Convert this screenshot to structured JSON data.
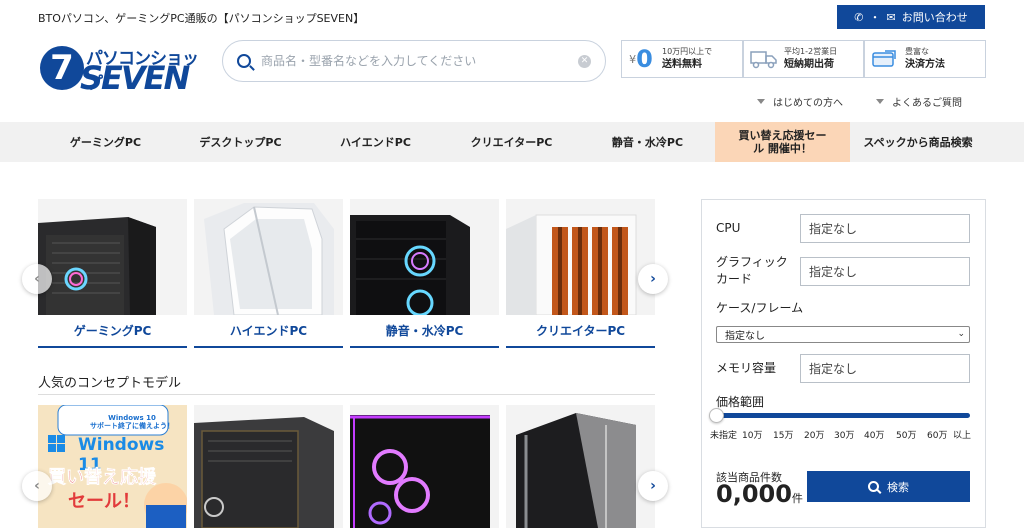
{
  "header": {
    "tagline": "BTOパソコン、ゲーミングPC通販の【パソコンショップSEVEN】",
    "contact_label": "お問い合わせ",
    "logo_small": "パソコンショップ",
    "logo_big": "SEVEN",
    "logo_digit": "7"
  },
  "search": {
    "placeholder": "商品名・型番名などを入力してください"
  },
  "info": [
    {
      "small": "10万円以上で",
      "bold": "送料無料",
      "icon": "free-shipping-icon",
      "zero": "0",
      "yen": "¥"
    },
    {
      "small": "平均1-2営業日",
      "bold": "短納期出荷",
      "icon": "truck-icon"
    },
    {
      "small": "豊富な",
      "bold": "決済方法",
      "icon": "payment-icon"
    }
  ],
  "help_links": [
    {
      "label": "はじめての方へ"
    },
    {
      "label": "よくあるご質問"
    }
  ],
  "nav": [
    {
      "label": "ゲーミングPC"
    },
    {
      "label": "デスクトップPC"
    },
    {
      "label": "ハイエンドPC"
    },
    {
      "label": "クリエイターPC"
    },
    {
      "label": "静音・水冷PC"
    },
    {
      "label": "買い替え応援セール 開催中！"
    },
    {
      "label": "スペックから商品検索"
    }
  ],
  "categories": [
    {
      "label": "ゲーミングPC"
    },
    {
      "label": "ハイエンドPC"
    },
    {
      "label": "静音・水冷PC"
    },
    {
      "label": "クリエイターPC"
    }
  ],
  "concept": {
    "title": "人気のコンセプトモデル",
    "banner_line1": "Windows 10",
    "banner_line2": "サポート終了に備えよう！",
    "banner_os": "Windows 11",
    "banner_sale1": "買い替え応援",
    "banner_sale2": "セール！"
  },
  "panel": {
    "cpu_label": "CPU",
    "cpu_value": "指定なし",
    "gpu_label": "グラフィック\nカード",
    "gpu_value": "指定なし",
    "case_label": "ケース/フレーム",
    "case_value": "指定なし",
    "mem_label": "メモリ容量",
    "mem_value": "指定なし",
    "price_label": "価格範囲",
    "price_ticks": [
      "未指定",
      "10万",
      "15万",
      "20万",
      "30万",
      "40万",
      "50万",
      "60万",
      "以上"
    ],
    "price_min_fraction": 0,
    "price_max_fraction": 1,
    "count_label": "該当商品件数",
    "count_value": "0,000",
    "count_unit": "件",
    "search_button": "検索"
  },
  "colors": {
    "brand": "#10489a",
    "sale_bg": "#fbd6b7",
    "nav_bg": "#f1f1f1"
  }
}
